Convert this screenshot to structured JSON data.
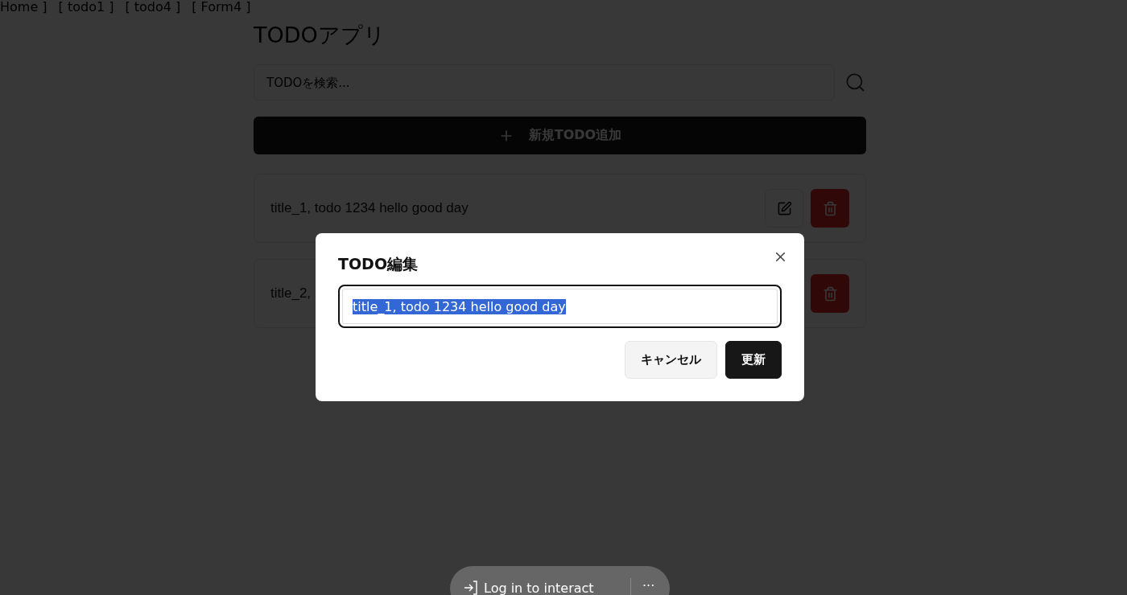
{
  "nav": [
    "Home ]",
    "[ todo1 ]",
    "[ todo4 ]",
    "[ Form4 ]"
  ],
  "title": "TODOアプリ",
  "search": {
    "placeholder": "TODOを検索..."
  },
  "add_button": "新規TODO追加",
  "todos": [
    {
      "title": "title_1, todo 1234 hello good day",
      "edit_visible": true
    },
    {
      "title": "title_2,",
      "edit_visible": false
    }
  ],
  "dialog": {
    "title": "TODO編集",
    "value": "title_1, todo 1234 hello good day",
    "text_selected": true,
    "buttons": [
      {
        "label": "キャンセル",
        "kind": "secondary"
      },
      {
        "label": "更新",
        "kind": "primary"
      }
    ]
  },
  "login_bar": {
    "label": "Log in to interact",
    "more": "···"
  }
}
